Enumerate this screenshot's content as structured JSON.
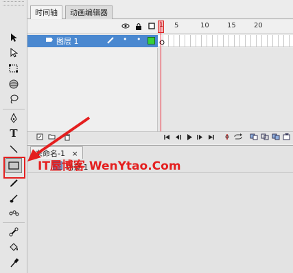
{
  "tabs": {
    "timeline": "时间轴",
    "motion_editor": "动画编辑器"
  },
  "layer": {
    "name": "图层 1"
  },
  "ruler_numbers": [
    "1",
    "5",
    "10",
    "15",
    "20"
  ],
  "document": {
    "tab_label": "未命名-1",
    "close": "×",
    "scene": "场景 1"
  },
  "watermark": "IT屋博客 WenYtao.Com",
  "tools": [
    "selection",
    "subselection",
    "free-transform",
    "3d-rotation",
    "lasso",
    "pen",
    "text",
    "line",
    "rectangle",
    "pencil",
    "brush",
    "deco",
    "bone",
    "paint-bucket",
    "eyedropper"
  ],
  "text_tool_label": "T",
  "colors": {
    "layer_highlight": "#4a88d0",
    "playhead": "#e23",
    "watermark": "#e41f1f"
  }
}
